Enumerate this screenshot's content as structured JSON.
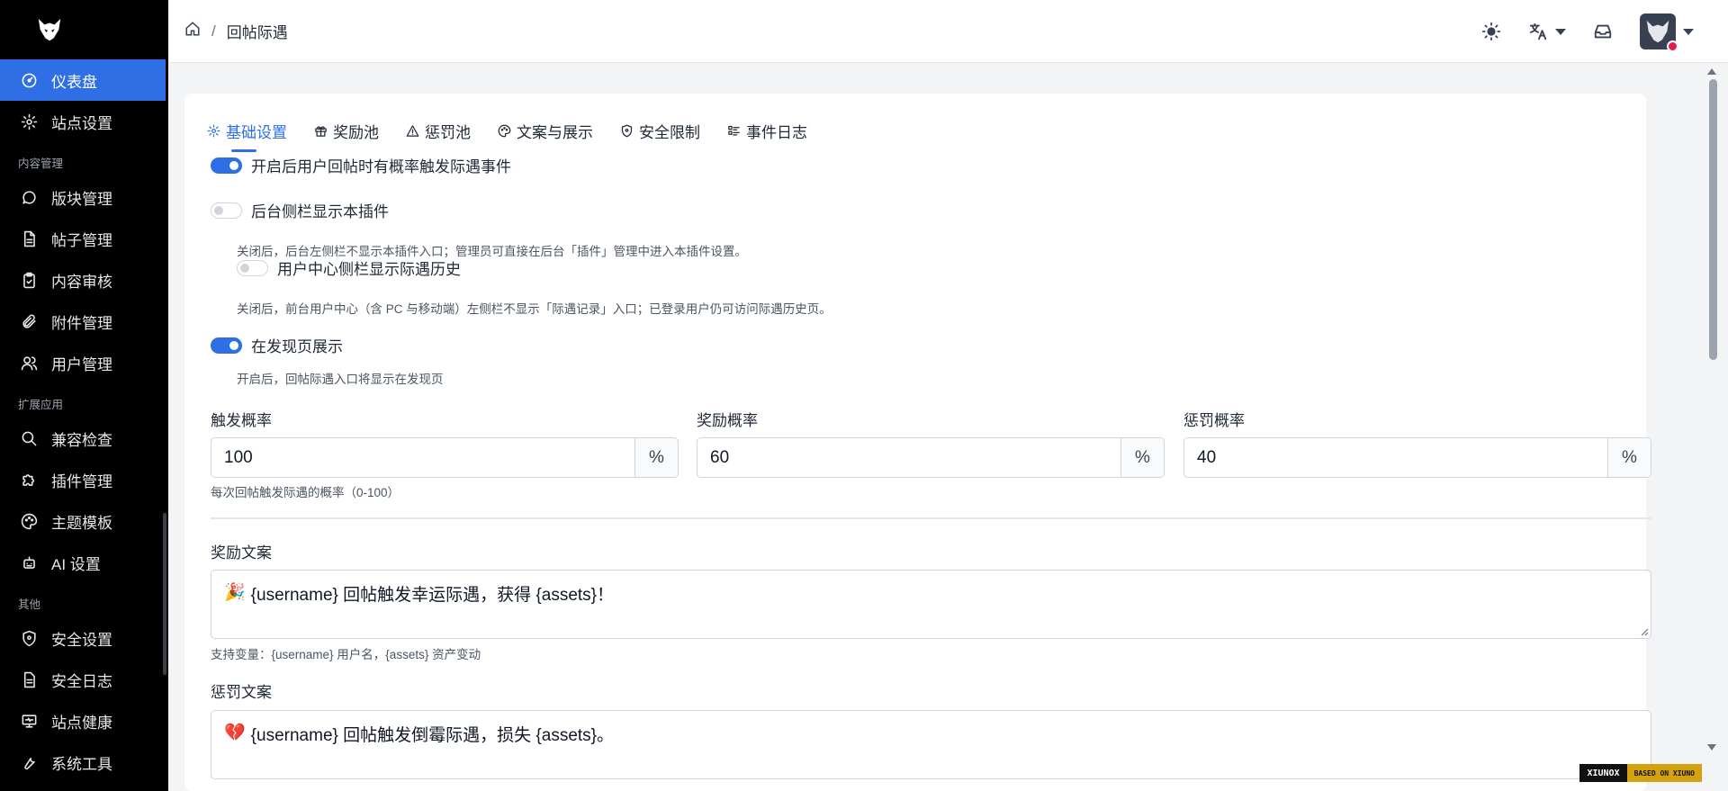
{
  "sidebar": {
    "items": [
      {
        "label": "仪表盘",
        "icon": "gauge-icon",
        "active": true
      },
      {
        "label": "站点设置",
        "icon": "gear-icon"
      },
      {
        "group": "内容管理"
      },
      {
        "label": "版块管理",
        "icon": "chat-bubble-icon"
      },
      {
        "label": "帖子管理",
        "icon": "document-icon"
      },
      {
        "label": "内容审核",
        "icon": "clipboard-check-icon"
      },
      {
        "label": "附件管理",
        "icon": "paperclip-icon"
      },
      {
        "label": "用户管理",
        "icon": "users-icon"
      },
      {
        "group": "扩展应用"
      },
      {
        "label": "兼容检查",
        "icon": "search-icon"
      },
      {
        "label": "插件管理",
        "icon": "puzzle-icon"
      },
      {
        "label": "主题模板",
        "icon": "palette-icon"
      },
      {
        "label": "AI 设置",
        "icon": "robot-icon"
      },
      {
        "group": "其他"
      },
      {
        "label": "安全设置",
        "icon": "shield-icon"
      },
      {
        "label": "安全日志",
        "icon": "log-icon"
      },
      {
        "label": "站点健康",
        "icon": "monitor-icon"
      },
      {
        "label": "系统工具",
        "icon": "tool-icon"
      }
    ]
  },
  "header": {
    "breadcrumb": "回帖际遇"
  },
  "tabs": [
    {
      "label": "基础设置",
      "icon": "gear-icon",
      "active": true
    },
    {
      "label": "奖励池",
      "icon": "gift-icon"
    },
    {
      "label": "惩罚池",
      "icon": "warning-icon"
    },
    {
      "label": "文案与展示",
      "icon": "palette-icon"
    },
    {
      "label": "安全限制",
      "icon": "shield-icon"
    },
    {
      "label": "事件日志",
      "icon": "list-icon"
    }
  ],
  "settings": {
    "enable_label": "开启后用户回帖时有概率触发际遇事件",
    "sidebar_label": "后台侧栏显示本插件",
    "sidebar_help": "关闭后，后台左侧栏不显示本插件入口；管理员可直接在后台「插件」管理中进入本插件设置。",
    "usercenter_label": "用户中心侧栏显示际遇历史",
    "usercenter_help": "关闭后，前台用户中心（含 PC 与移动端）左侧栏不显示「际遇记录」入口；已登录用户仍可访问际遇历史页。",
    "discover_label": "在发现页展示",
    "discover_help": "开启后，回帖际遇入口将显示在发现页"
  },
  "probabilities": {
    "trigger_label": "触发概率",
    "trigger_value": "100",
    "trigger_help": "每次回帖触发际遇的概率（0-100）",
    "reward_label": "奖励概率",
    "reward_value": "60",
    "penalty_label": "惩罚概率",
    "penalty_value": "40",
    "suffix": "%"
  },
  "copy": {
    "reward_label": "奖励文案",
    "reward_text": "{username} 回帖触发幸运际遇，获得 {assets}！",
    "reward_help": "支持变量：{username} 用户名，{assets} 资产变动",
    "penalty_label": "惩罚文案",
    "penalty_text": "{username} 回帖触发倒霉际遇，损失 {assets}。"
  },
  "footer_badge": {
    "left": "XIUNOX",
    "right": "BASED ON XIUNO"
  },
  "colors": {
    "accent": "#2f6fe6",
    "sidebar_bg": "#000000"
  }
}
